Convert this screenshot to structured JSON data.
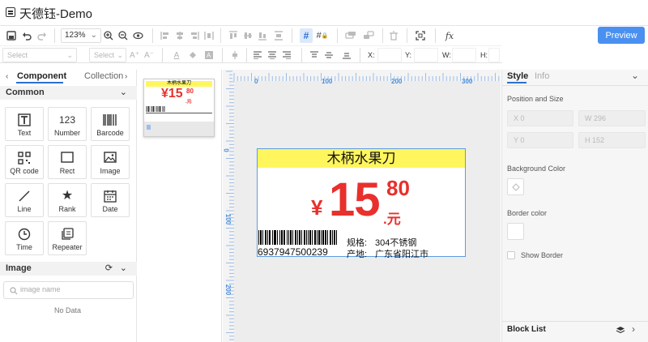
{
  "app": {
    "title": "天德钰-Demo",
    "preview_label": "Preview"
  },
  "toolbar": {
    "zoom": "123%",
    "fx": "fx"
  },
  "format_bar": {
    "font_placeholder": "Select",
    "size_placeholder": "Select",
    "x_label": "X:",
    "y_label": "Y:",
    "w_label": "W:",
    "h_label": "H:"
  },
  "left_panel": {
    "tabs": [
      {
        "label": "Component"
      },
      {
        "label": "Collection"
      }
    ],
    "common_title": "Common",
    "components": [
      {
        "label": "Text"
      },
      {
        "label": "Number"
      },
      {
        "label": "Barcode"
      },
      {
        "label": "QR code"
      },
      {
        "label": "Rect"
      },
      {
        "label": "Image"
      },
      {
        "label": "Line"
      },
      {
        "label": "Rank"
      },
      {
        "label": "Date"
      },
      {
        "label": "Time"
      },
      {
        "label": "Repeater"
      }
    ],
    "image_section": {
      "title": "Image",
      "search_placeholder": "image name",
      "empty_text": "No Data"
    }
  },
  "thumbnail": {
    "title": "木柄水果刀",
    "price": "¥15",
    "cents": "80",
    "unit": ".元"
  },
  "ruler": {
    "top": [
      "0",
      "100",
      "200",
      "300"
    ],
    "left": [
      "0",
      "100",
      "200"
    ]
  },
  "label": {
    "title": "木柄水果刀",
    "title_bg": "#fff65e",
    "currency": "¥",
    "price_int": "15",
    "cents": "80",
    "unit": ".元",
    "price_color": "#e8302c",
    "barcode": "6937947500239",
    "spec_label": "规格:",
    "spec_value": "304不锈钢",
    "origin_label": "产地:",
    "origin_value": "广东省阳江市"
  },
  "right_panel": {
    "tabs": [
      {
        "label": "Style"
      },
      {
        "label": "Info"
      }
    ],
    "position_title": "Position and Size",
    "fields": {
      "x": "X  0",
      "w": "W  296",
      "y": "Y  0",
      "h": "H  152"
    },
    "bg_title": "Background Color",
    "border_title": "Border color",
    "show_border": "Show Border",
    "block_list": "Block List"
  }
}
